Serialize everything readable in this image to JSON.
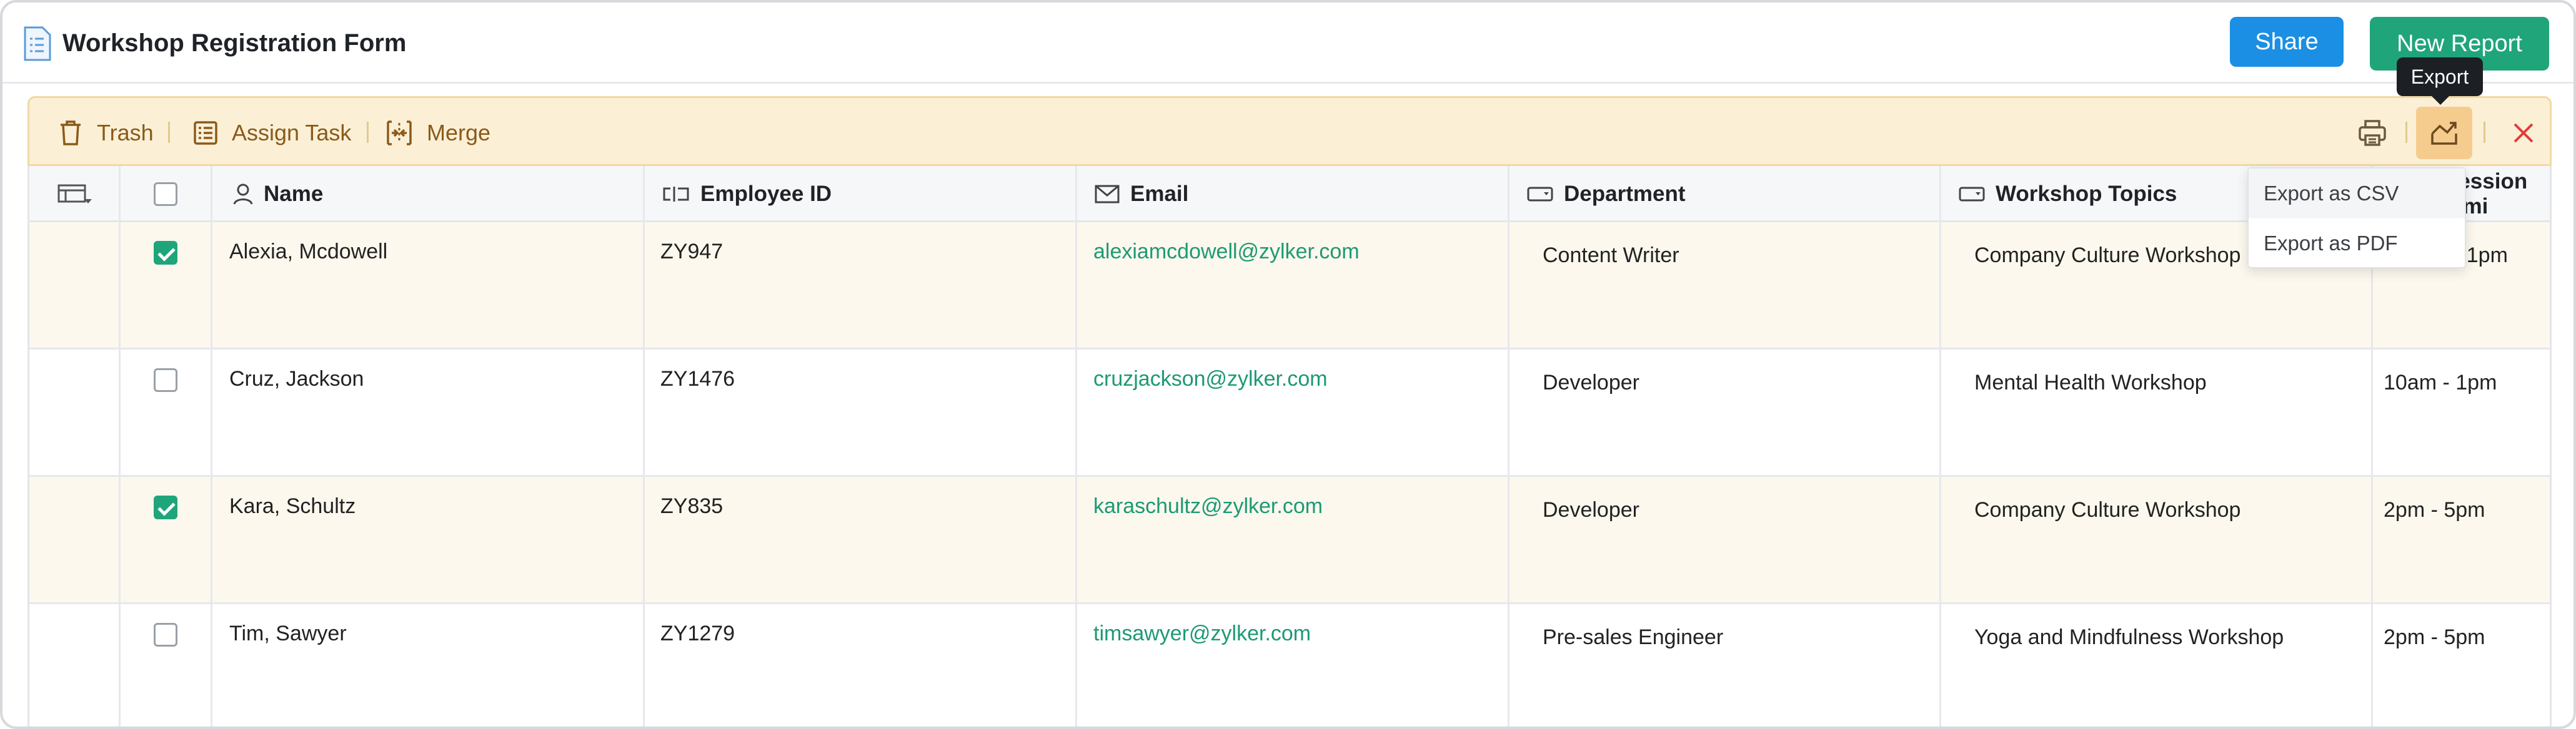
{
  "header": {
    "title": "Workshop Registration Form",
    "share_label": "Share",
    "new_report_label": "New Report"
  },
  "tooltip": "Export",
  "actions": {
    "trash": "Trash",
    "assign_task": "Assign Task",
    "merge": "Merge"
  },
  "columns": [
    "Name",
    "Employee ID",
    "Email",
    "Department",
    "Workshop Topics",
    "Session Timi"
  ],
  "rows": [
    {
      "selected": true,
      "name": "Alexia, Mcdowell",
      "employee_id": "ZY947",
      "email": "alexiamcdowell@zylker.com",
      "department": "Content Writer",
      "topic": "Company Culture Workshop",
      "session": "- 1pm"
    },
    {
      "selected": false,
      "name": "Cruz, Jackson",
      "employee_id": "ZY1476",
      "email": "cruzjackson@zylker.com",
      "department": "Developer",
      "topic": "Mental Health Workshop",
      "session": "10am - 1pm"
    },
    {
      "selected": true,
      "name": "Kara, Schultz",
      "employee_id": "ZY835",
      "email": "karaschultz@zylker.com",
      "department": "Developer",
      "topic": "Company Culture Workshop",
      "session": "2pm - 5pm"
    },
    {
      "selected": false,
      "name": "Tim, Sawyer",
      "employee_id": "ZY1279",
      "email": "timsawyer@zylker.com",
      "department": "Pre-sales Engineer",
      "topic": "Yoga and Mindfulness Workshop",
      "session": "2pm - 5pm"
    }
  ],
  "export_menu": [
    "Export as CSV",
    "Export as PDF"
  ],
  "colors": {
    "share": "#1a8fe3",
    "new_report": "#20a57a",
    "action_bar": "#fbf0d6",
    "email_link": "#1c9a74",
    "close": "#e03b3b"
  }
}
